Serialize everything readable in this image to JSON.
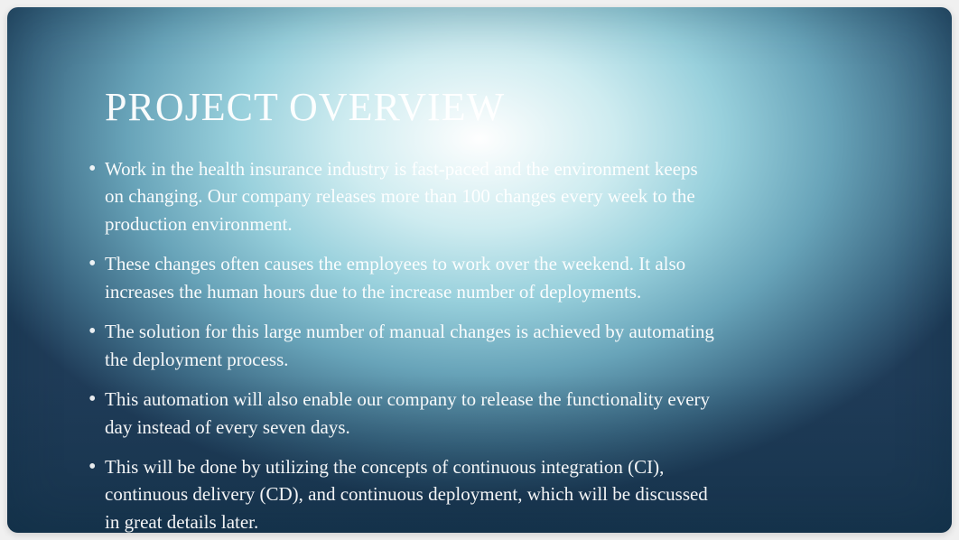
{
  "slide": {
    "title": "PROJECT OVERVIEW",
    "bullets": [
      "Work in the health insurance industry is fast-paced and the environment keeps on changing. Our company releases more than 100 changes every week to the production environment.",
      "These changes often causes the employees to work over the weekend. It also increases the human hours due to the increase number of deployments.",
      "The solution for this large number of manual changes is achieved by automating the deployment process.",
      "This automation will also enable our company to release the functionality every day instead of every seven days.",
      "This will be done by utilizing the concepts of continuous integration (CI), continuous delivery (CD), and continuous deployment, which will be discussed in great details later."
    ]
  }
}
